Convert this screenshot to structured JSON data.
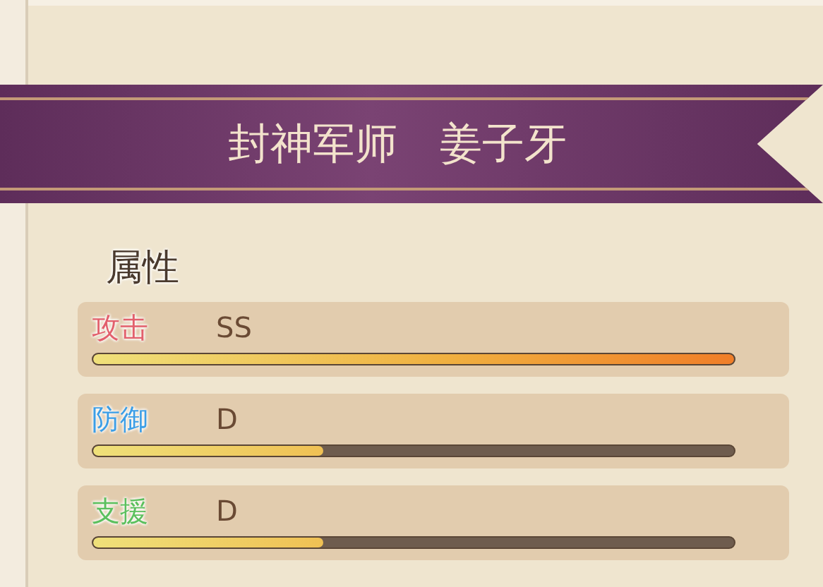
{
  "banner": {
    "title": "封神军师",
    "name": "姜子牙"
  },
  "section": {
    "title": "属性"
  },
  "attributes": [
    {
      "label": "攻击",
      "color": "#e2606c",
      "grade": "SS",
      "level": 1.0
    },
    {
      "label": "防御",
      "color": "#3c9ee6",
      "grade": "D",
      "level": 0.36
    },
    {
      "label": "支援",
      "color": "#5cc05e",
      "grade": "D",
      "level": 0.36
    }
  ]
}
